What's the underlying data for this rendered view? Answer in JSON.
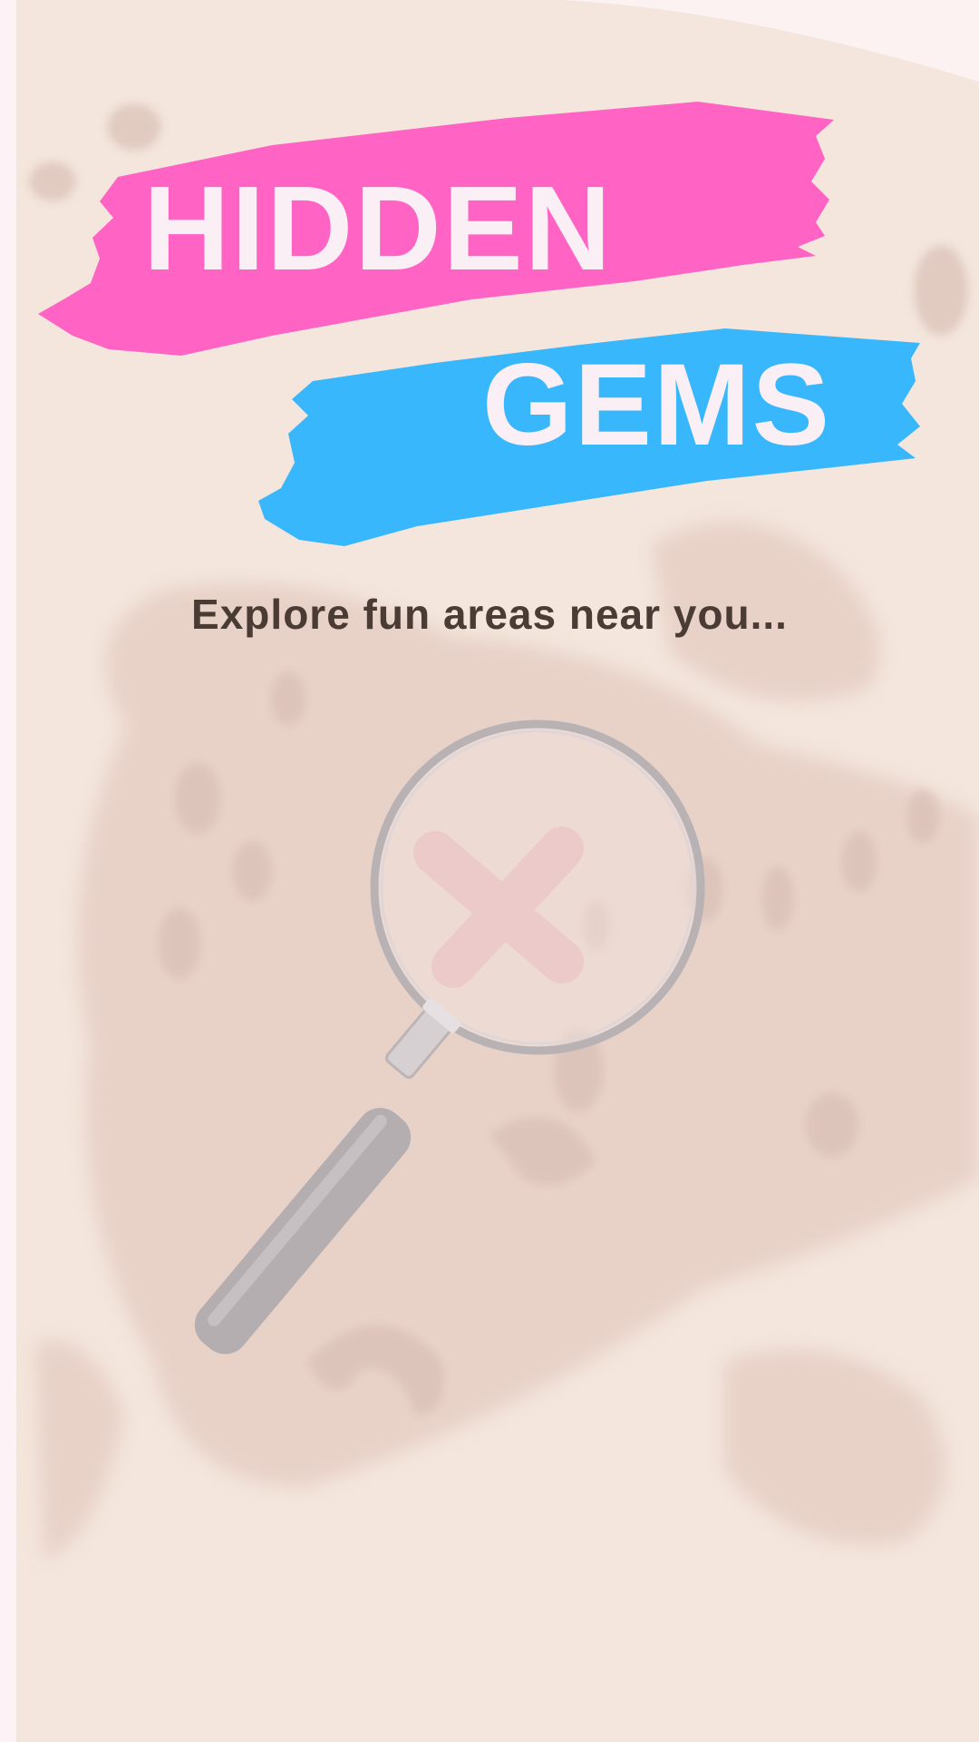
{
  "app": {
    "title_line1": "HIDDEN",
    "title_line2": "GEMS",
    "tagline": "Explore fun areas near you..."
  },
  "colors": {
    "pink_brush": "#ff63c3",
    "blue_brush": "#39b7fd",
    "title_text": "#fbeff6",
    "tagline_text": "#4a3c34",
    "map_paper": "#f3e4da",
    "map_land": "#e7d1c8",
    "magnifier_ring": "#b9b2b4",
    "x_mark": "#e8b1b8"
  },
  "icons": {
    "illustration": "magnifying-glass-over-x-mark",
    "background": "treasure-map"
  }
}
